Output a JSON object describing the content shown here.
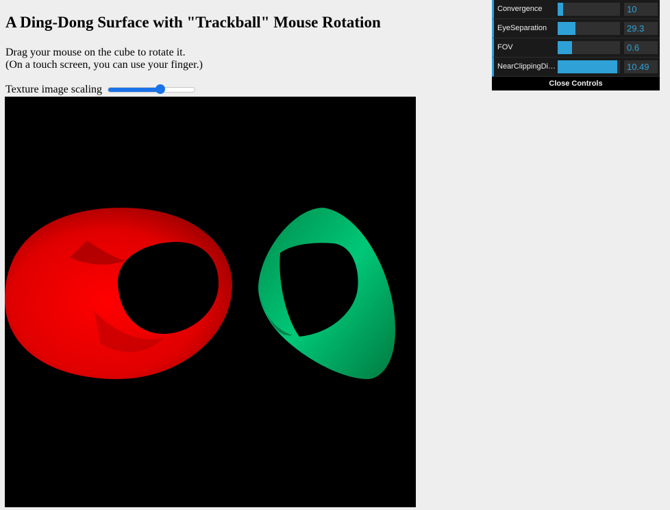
{
  "page": {
    "title": "A Ding-Dong Surface with \"Trackball\" Mouse Rotation",
    "instruction_line1": "Drag your mouse on the cube to rotate it.",
    "instruction_line2": "(On a touch screen, you can use your finger.)",
    "slider_label": "Texture image scaling",
    "slider_value_fraction": 0.6
  },
  "gui": {
    "controls": [
      {
        "label": "Convergence",
        "value": "10",
        "fill_fraction": 0.09
      },
      {
        "label": "EyeSeparation",
        "value": "29.3",
        "fill_fraction": 0.29
      },
      {
        "label": "FOV",
        "value": "0.6",
        "fill_fraction": 0.23
      },
      {
        "label": "NearClippingDis...",
        "value": "10.49",
        "fill_fraction": 0.96
      }
    ],
    "close_label": "Close Controls",
    "accent_color": "#2fa1d6"
  },
  "scene": {
    "background_color": "#000000",
    "left_object_color": "#ff0000",
    "right_object_color": "#00a060"
  }
}
